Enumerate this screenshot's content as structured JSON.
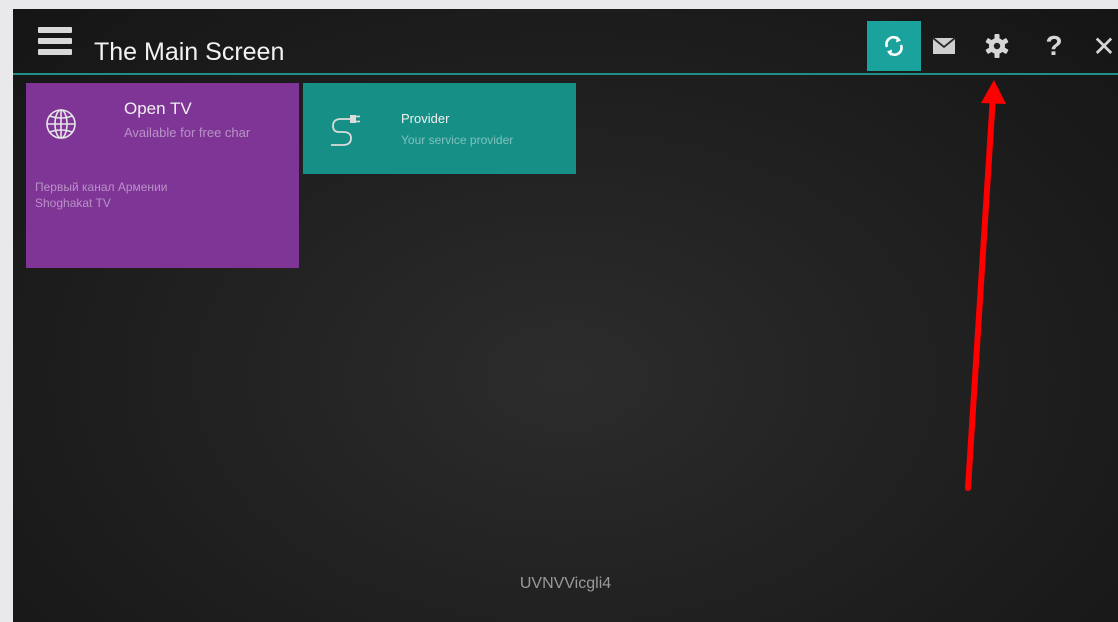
{
  "header": {
    "title": "The Main Screen",
    "icons": {
      "menu": "hamburger-menu-icon",
      "refresh": "refresh-icon",
      "mail": "mail-icon",
      "settings": "gear-icon",
      "help": "?",
      "close": "✕"
    }
  },
  "tiles": [
    {
      "title": "Open TV",
      "subtitle": "Available for free char",
      "channels": [
        "Первый канал Армении",
        "Shoghakat TV"
      ],
      "icon": "globe-icon",
      "color": "#7e3596"
    },
    {
      "title": "Provider",
      "subtitle": "Your service provider",
      "icon": "cable-plug-icon",
      "color": "#168f86"
    }
  ],
  "footer": {
    "code": "UVNVVicgli4"
  },
  "colors": {
    "accent": "#1aa39c",
    "background": "#1f1f1f",
    "annotation": "#ff0000"
  },
  "annotation": {
    "type": "arrow",
    "points_to": "settings-button"
  }
}
